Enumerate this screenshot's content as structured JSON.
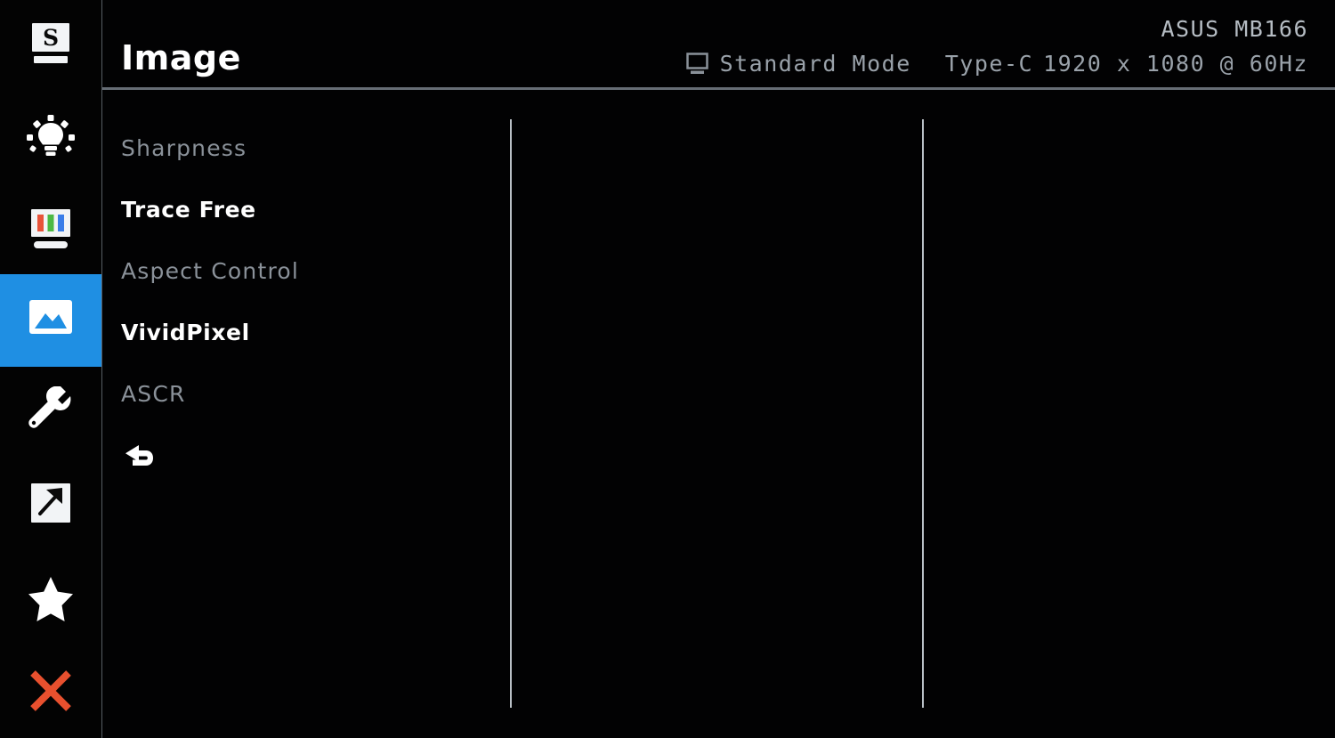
{
  "header": {
    "title": "Image",
    "model_name": "ASUS MB166",
    "display_icon": "monitor-icon",
    "preset_mode": "Standard Mode",
    "input_source": "Type-C",
    "resolution": "1920 x 1080 @ 60Hz"
  },
  "sidebar": {
    "accent_color": "#1f8fe3",
    "exit_color": "#e8502e",
    "items": [
      {
        "name": "splendid",
        "icon": "monitor-s-icon",
        "selected": false
      },
      {
        "name": "blue-light-filter",
        "icon": "lightbulb-icon",
        "selected": false
      },
      {
        "name": "color",
        "icon": "color-bars-icon",
        "selected": false
      },
      {
        "name": "image",
        "icon": "picture-icon",
        "selected": true
      },
      {
        "name": "system-setup",
        "icon": "wrench-icon",
        "selected": false
      },
      {
        "name": "input-select",
        "icon": "arrow-up-right-icon",
        "selected": false
      },
      {
        "name": "shortcut",
        "icon": "star-icon",
        "selected": false
      },
      {
        "name": "exit",
        "icon": "close-x-icon",
        "selected": false
      }
    ]
  },
  "menu": {
    "items": [
      {
        "label": "Sharpness",
        "active": false
      },
      {
        "label": "Trace Free",
        "active": true
      },
      {
        "label": "Aspect Control",
        "active": false
      },
      {
        "label": "VividPixel",
        "active": true
      },
      {
        "label": "ASCR",
        "active": false
      }
    ],
    "back": {
      "icon": "back-arrow-icon",
      "label": ""
    }
  }
}
